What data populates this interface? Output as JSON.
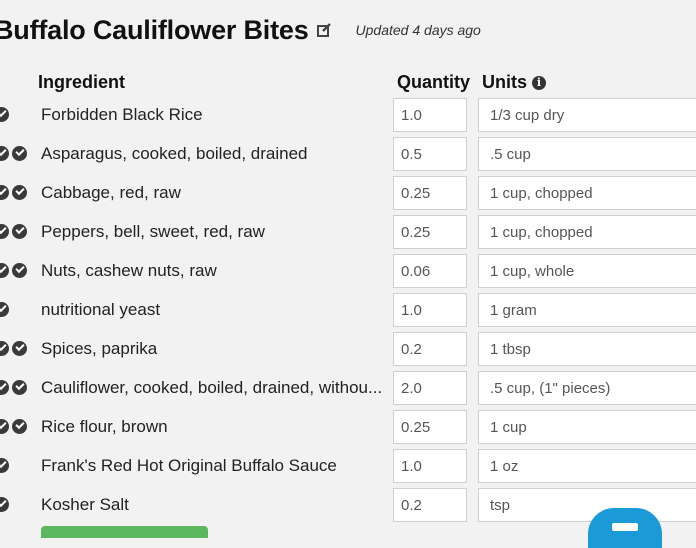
{
  "recipe": {
    "title": "Buffalo Cauliflower Bites",
    "updated": "Updated 4 days ago"
  },
  "headers": {
    "ingredient": "Ingredient",
    "quantity": "Quantity",
    "units": "Units"
  },
  "ingredients": [
    {
      "name": "Forbidden Black Rice",
      "quantity": "1.0",
      "units": "1/3 cup dry",
      "checks": 1
    },
    {
      "name": "Asparagus, cooked, boiled, drained",
      "quantity": "0.5",
      "units": ".5 cup",
      "checks": 2
    },
    {
      "name": "Cabbage, red, raw",
      "quantity": "0.25",
      "units": "1 cup, chopped",
      "checks": 2
    },
    {
      "name": "Peppers, bell, sweet, red, raw",
      "quantity": "0.25",
      "units": "1 cup, chopped",
      "checks": 2
    },
    {
      "name": "Nuts, cashew nuts, raw",
      "quantity": "0.06",
      "units": "1 cup, whole",
      "checks": 2
    },
    {
      "name": "nutritional yeast",
      "quantity": "1.0",
      "units": "1 gram",
      "checks": 1
    },
    {
      "name": "Spices, paprika",
      "quantity": "0.2",
      "units": "1 tbsp",
      "checks": 2
    },
    {
      "name": "Cauliflower, cooked, boiled, drained, withou...",
      "quantity": "2.0",
      "units": ".5 cup, (1\" pieces)",
      "checks": 2
    },
    {
      "name": "Rice flour, brown",
      "quantity": "0.25",
      "units": "1 cup",
      "checks": 2
    },
    {
      "name": "Frank's Red Hot Original Buffalo Sauce",
      "quantity": "1.0",
      "units": "1 oz",
      "checks": 1
    },
    {
      "name": "Kosher Salt",
      "quantity": "0.2",
      "units": "tsp",
      "checks": 1
    }
  ],
  "icons": {
    "edit": "edit-icon",
    "info": "info-icon",
    "check": "check-circle-icon",
    "chat": "chat-icon"
  },
  "colors": {
    "accent_green": "#5cb85c",
    "chat_blue": "#1a9bd7",
    "check_dark": "#3a3a3a"
  }
}
